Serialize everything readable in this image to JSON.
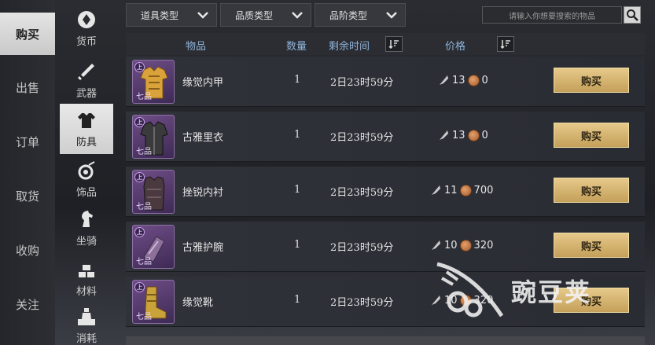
{
  "main_nav": [
    "购买",
    "出售",
    "订单",
    "取货",
    "收购",
    "关注"
  ],
  "categories": [
    {
      "label": "货币",
      "icon": "currency-icon"
    },
    {
      "label": "武器",
      "icon": "sword-icon"
    },
    {
      "label": "防具",
      "icon": "armor-icon"
    },
    {
      "label": "饰品",
      "icon": "accessory-icon"
    },
    {
      "label": "坐骑",
      "icon": "horse-icon"
    },
    {
      "label": "材料",
      "icon": "materials-icon"
    },
    {
      "label": "消耗",
      "icon": "consumable-icon"
    }
  ],
  "filters": [
    "道具类型",
    "品质类型",
    "品阶类型"
  ],
  "search": {
    "placeholder": "请输入你想要搜索的物品"
  },
  "table": {
    "headers": {
      "item": "物品",
      "qty": "数量",
      "time": "剩余时间",
      "price": "价格"
    }
  },
  "rows": [
    {
      "name": "缘觉内甲",
      "qty": "1",
      "time": "2日23时59分",
      "feather": "13",
      "coin": "0",
      "buy": "购买",
      "tier": "上",
      "grade": "七品",
      "item_icon": "golden-armor-icon"
    },
    {
      "name": "古雅里衣",
      "qty": "1",
      "time": "2日23时59分",
      "feather": "13",
      "coin": "0",
      "buy": "购买",
      "tier": "上",
      "grade": "七品",
      "item_icon": "dark-robe-icon"
    },
    {
      "name": "挫锐内衬",
      "qty": "1",
      "time": "2日23时59分",
      "feather": "11",
      "coin": "700",
      "buy": "购买",
      "tier": "上",
      "grade": "七品",
      "item_icon": "dark-vest-icon"
    },
    {
      "name": "古雅护腕",
      "qty": "1",
      "time": "2日23时59分",
      "feather": "10",
      "coin": "320",
      "buy": "购买",
      "tier": "上",
      "grade": "七品",
      "item_icon": "bracer-icon"
    },
    {
      "name": "缘觉靴",
      "qty": "1",
      "time": "2日23时59分",
      "feather": "10",
      "coin": "320",
      "buy": "购买",
      "tier": "上",
      "grade": "七品",
      "item_icon": "golden-boots-icon"
    }
  ],
  "watermark": "豌豆荚",
  "colors": {
    "buy_button": "#d9b873",
    "header_text": "#8fb3d9",
    "grade_bg": "#5a3d75"
  }
}
